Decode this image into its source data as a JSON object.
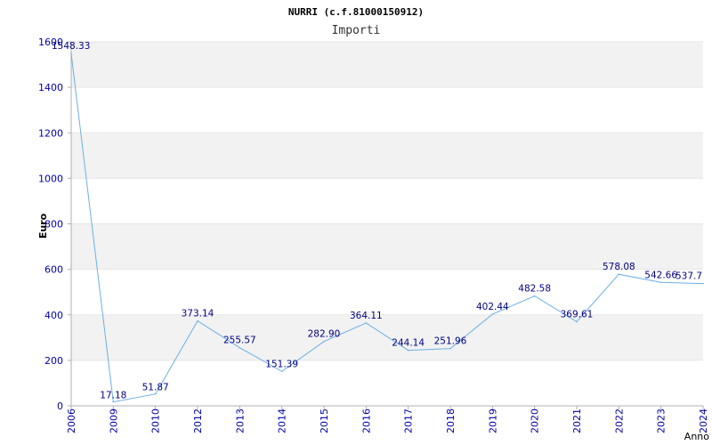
{
  "chart_data": {
    "type": "line",
    "title": "NURRI (c.f.81000150912)",
    "subtitle": "Importi",
    "xlabel": "Anno",
    "ylabel": "Euro",
    "ylim": [
      0,
      1600
    ],
    "yticks": [
      0,
      200,
      400,
      600,
      800,
      1000,
      1200,
      1400,
      1600
    ],
    "categories": [
      "2006",
      "2009",
      "2010",
      "2012",
      "2013",
      "2014",
      "2015",
      "2016",
      "2017",
      "2018",
      "2019",
      "2020",
      "2021",
      "2022",
      "2023",
      "2024"
    ],
    "values": [
      1548.33,
      17.18,
      51.87,
      373.14,
      255.57,
      151.39,
      282.9,
      364.11,
      244.14,
      251.96,
      402.44,
      482.58,
      369.61,
      578.08,
      542.66,
      537.7
    ],
    "value_labels": [
      "1548.33",
      "17.18",
      "51.87",
      "373.14",
      "255.57",
      "151.39",
      "282.90",
      "364.11",
      "244.14",
      "251.96",
      "402.44",
      "482.58",
      "369.61",
      "578.08",
      "542.66",
      "537.7"
    ],
    "grid": true,
    "band_colors": [
      "#f2f2f2",
      "#ffffff"
    ],
    "line_color": "#6ab0e6",
    "tick_color": "#0000aa",
    "label_color": "#000080"
  }
}
